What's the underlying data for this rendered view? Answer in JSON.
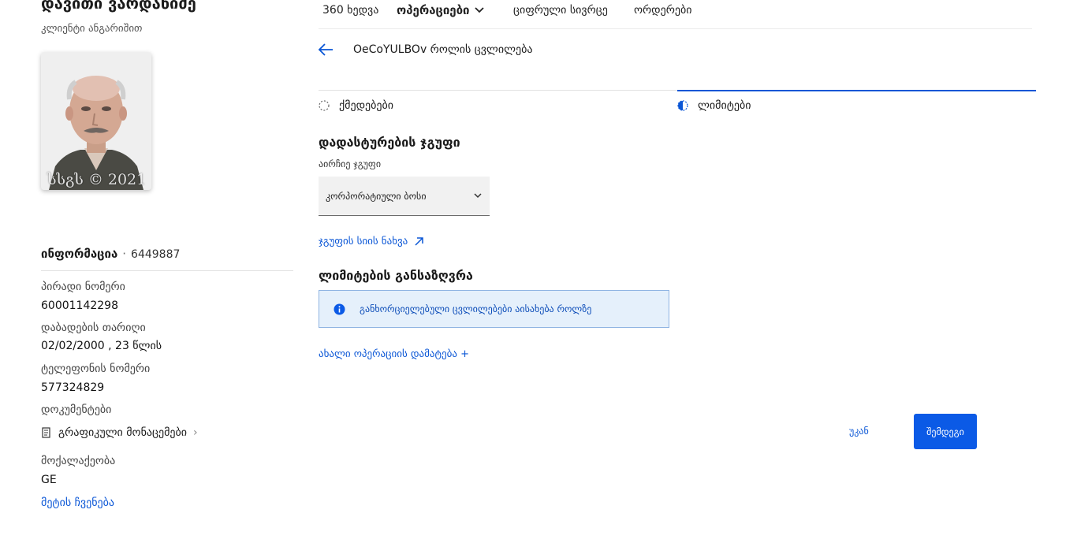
{
  "client": {
    "name": "დავითი ვარდანიძე",
    "subtitle": "კლიენტი ანგარიშით",
    "photo_watermark": "სსგს © 2021"
  },
  "info": {
    "title": "ინფორმაცია",
    "id": "6449887",
    "fields": [
      {
        "label": "პირადი ნომერი",
        "value": "60001142298"
      },
      {
        "label": "დაბადების თარიღი",
        "value": "02/02/2000 , 23 წლის"
      },
      {
        "label": "ტელეფონის ნომერი",
        "value": "577324829"
      },
      {
        "label": "დოკუმენტები",
        "value": "გრაფიკული მონაცემები"
      },
      {
        "label": "მოქალაქეობა",
        "value": "GE"
      }
    ],
    "more_link": "მეტის ჩვენება"
  },
  "topnav": {
    "items": [
      "360 ხედვა",
      "ოპერაციები",
      "ციფრული სივრცე",
      "ორდერები"
    ]
  },
  "header": {
    "title": "OeCoYULBOv როლის ცვლილება"
  },
  "steps": [
    {
      "label": "ქმედებები",
      "state": "pending"
    },
    {
      "label": "ლიმიტები",
      "state": "active"
    }
  ],
  "form": {
    "approval_group_title": "დადასტურების ჯგუფი",
    "select_label": "აირჩიე ჯგუფი",
    "select_value": "კორპორატიული ბოსი",
    "view_group_link": "ჯგუფის სიის ნახვა",
    "limits_title": "ლიმიტების განსაზღვრა",
    "notice_text": "განხორციელებული ცვლილებები აისახება როლზე",
    "add_operation_link": "ახალი ოპერაციის დამატება +"
  },
  "actions": {
    "back": "უკან",
    "next": "შემდეგი"
  },
  "colors": {
    "accent": "#0b5ae6",
    "link": "#0a56d6",
    "notice_bg": "#e5f0fb"
  }
}
